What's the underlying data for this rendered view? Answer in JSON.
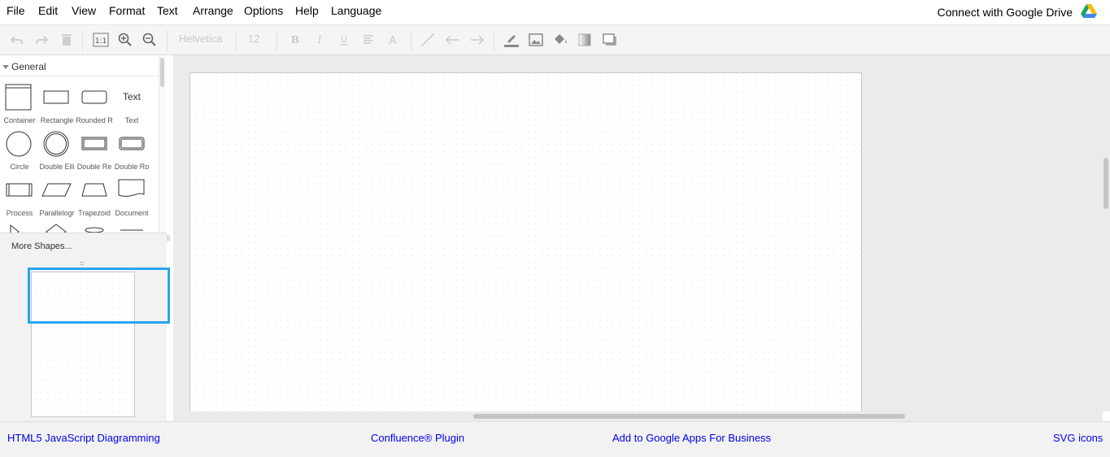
{
  "menubar": {
    "items": [
      "File",
      "Edit",
      "View",
      "Format",
      "Text",
      "Arrange",
      "Options",
      "Help",
      "Language"
    ],
    "google_drive": "Connect with Google Drive"
  },
  "toolbar": {
    "font_family": "Helvetica",
    "font_size": "12",
    "icons": [
      "undo-icon",
      "redo-icon",
      "delete-icon",
      "actual-size-icon",
      "zoom-in-icon",
      "zoom-out-icon",
      "bold-icon",
      "italic-icon",
      "underline-icon",
      "align-icon",
      "font-color-icon",
      "straight-connector-icon",
      "arrow-left-icon",
      "arrow-right-icon",
      "line-color-icon",
      "image-icon",
      "fill-color-icon",
      "gradient-icon",
      "shadow-icon"
    ]
  },
  "sidebar": {
    "palette_title": "General",
    "shapes": [
      {
        "label": "Container"
      },
      {
        "label": "Rectangle"
      },
      {
        "label": "Rounded R"
      },
      {
        "label": "Text",
        "glyph": "Text"
      },
      {
        "label": "Circle"
      },
      {
        "label": "Double Elli"
      },
      {
        "label": "Double Re"
      },
      {
        "label": "Double Ro"
      },
      {
        "label": "Process"
      },
      {
        "label": "Parallelogr"
      },
      {
        "label": "Trapezoid"
      },
      {
        "label": "Document"
      }
    ],
    "more_shapes": "More Shapes..."
  },
  "footer": {
    "links": [
      "HTML5 JavaScript Diagramming",
      "Confluence® Plugin",
      "Add to Google Apps For Business",
      "SVG icons"
    ]
  },
  "colors": {
    "accent": "#28a5f0",
    "link": "#0000ee",
    "toolbar_bg": "#f5f5f5",
    "canvas_bg": "#ebebeb"
  }
}
